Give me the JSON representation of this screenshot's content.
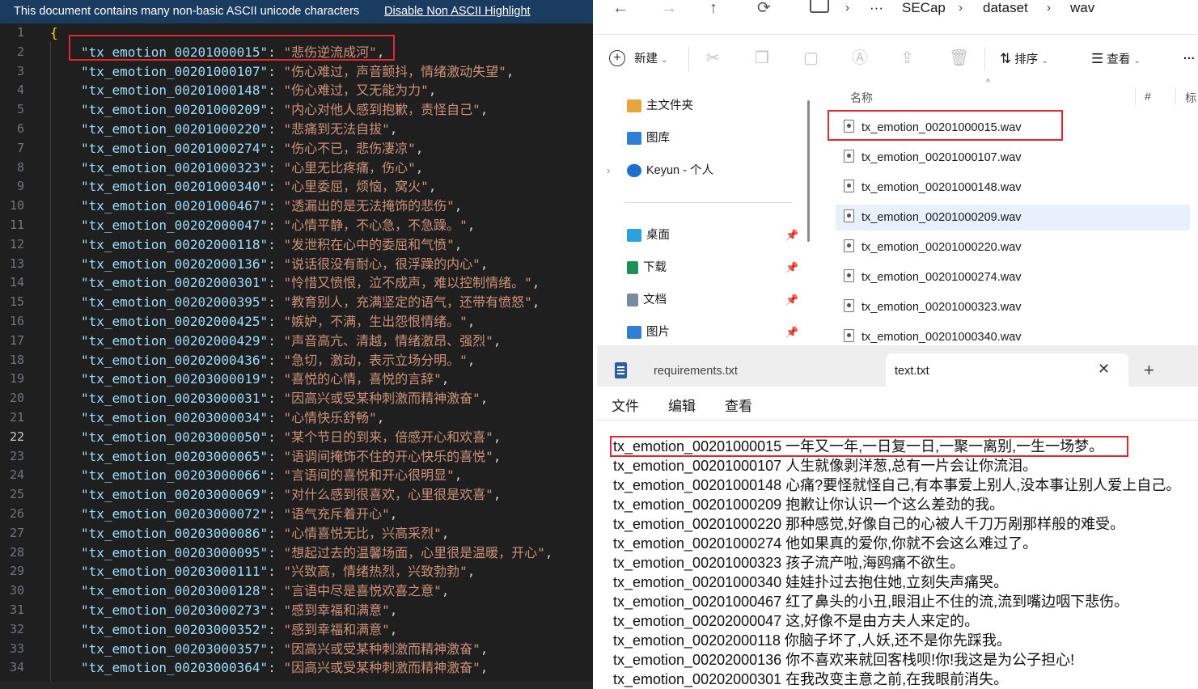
{
  "editor": {
    "banner": {
      "message": "This document contains many non-basic ASCII unicode characters",
      "link": "Disable Non ASCII Highlight"
    },
    "active_line": "22",
    "lines": [
      {
        "n": "1",
        "text": "{"
      },
      {
        "n": "2",
        "key": "\"tx_emotion_00201000015\"",
        "val": "\"悲伤逆流成河\"",
        "tail": ","
      },
      {
        "n": "3",
        "key": "\"tx_emotion_00201000107\"",
        "val": "\"伤心难过，声音颤抖，情绪激动失望\"",
        "tail": ","
      },
      {
        "n": "4",
        "key": "\"tx_emotion_00201000148\"",
        "val": "\"伤心难过，又无能为力\"",
        "tail": ","
      },
      {
        "n": "5",
        "key": "\"tx_emotion_00201000209\"",
        "val": "\"内心对他人感到抱歉，责怪自己\"",
        "tail": ","
      },
      {
        "n": "6",
        "key": "\"tx_emotion_00201000220\"",
        "val": "\"悲痛到无法自拔\"",
        "tail": ","
      },
      {
        "n": "7",
        "key": "\"tx_emotion_00201000274\"",
        "val": "\"伤心不已，悲伤凄凉\"",
        "tail": ","
      },
      {
        "n": "8",
        "key": "\"tx_emotion_00201000323\"",
        "val": "\"心里无比疼痛，伤心\"",
        "tail": ","
      },
      {
        "n": "9",
        "key": "\"tx_emotion_00201000340\"",
        "val": "\"心里委屈，烦恼，窝火\"",
        "tail": ","
      },
      {
        "n": "10",
        "key": "\"tx_emotion_00201000467\"",
        "val": "\"透漏出的是无法掩饰的悲伤\"",
        "tail": ","
      },
      {
        "n": "11",
        "key": "\"tx_emotion_00202000047\"",
        "val": "\"心情平静，不心急，不急躁。\"",
        "tail": ","
      },
      {
        "n": "12",
        "key": "\"tx_emotion_00202000118\"",
        "val": "\"发泄积在心中的委屈和气愤\"",
        "tail": ","
      },
      {
        "n": "13",
        "key": "\"tx_emotion_00202000136\"",
        "val": "\"说话很没有耐心，很浮躁的内心\"",
        "tail": ","
      },
      {
        "n": "14",
        "key": "\"tx_emotion_00202000301\"",
        "val": "\"怜惜又愤恨，泣不成声，难以控制情绪。\"",
        "tail": ","
      },
      {
        "n": "15",
        "key": "\"tx_emotion_00202000395\"",
        "val": "\"教育别人，充满坚定的语气，还带有愤怒\"",
        "tail": ","
      },
      {
        "n": "16",
        "key": "\"tx_emotion_00202000425\"",
        "val": "\"嫉妒，不满，生出怨恨情绪。\"",
        "tail": ","
      },
      {
        "n": "17",
        "key": "\"tx_emotion_00202000429\"",
        "val": "\"声音高亢、清越，情绪激昂、强烈\"",
        "tail": ","
      },
      {
        "n": "18",
        "key": "\"tx_emotion_00202000436\"",
        "val": "\"急切，激动，表示立场分明。\"",
        "tail": ","
      },
      {
        "n": "19",
        "key": "\"tx_emotion_00203000019\"",
        "val": "\"喜悦的心情，喜悦的言辞\"",
        "tail": ","
      },
      {
        "n": "20",
        "key": "\"tx_emotion_00203000031\"",
        "val": "\"因高兴或受某种刺激而精神激奋\"",
        "tail": ","
      },
      {
        "n": "21",
        "key": "\"tx_emotion_00203000034\"",
        "val": "\"心情快乐舒畅\"",
        "tail": ","
      },
      {
        "n": "22",
        "key": "\"tx_emotion_00203000050\"",
        "val": "\"某个节日的到来，倍感开心和欢喜\"",
        "tail": ","
      },
      {
        "n": "23",
        "key": "\"tx_emotion_00203000065\"",
        "val": "\"语调间掩饰不住的开心快乐的喜悦\"",
        "tail": ","
      },
      {
        "n": "24",
        "key": "\"tx_emotion_00203000066\"",
        "val": "\"言语间的喜悦和开心很明显\"",
        "tail": ","
      },
      {
        "n": "25",
        "key": "\"tx_emotion_00203000069\"",
        "val": "\"对什么感到很喜欢，心里很是欢喜\"",
        "tail": ","
      },
      {
        "n": "26",
        "key": "\"tx_emotion_00203000072\"",
        "val": "\"语气充斥着开心\"",
        "tail": ","
      },
      {
        "n": "27",
        "key": "\"tx_emotion_00203000086\"",
        "val": "\"心情喜悦无比，兴高采烈\"",
        "tail": ","
      },
      {
        "n": "28",
        "key": "\"tx_emotion_00203000095\"",
        "val": "\"想起过去的温馨场面，心里很是温暖，开心\"",
        "tail": ","
      },
      {
        "n": "29",
        "key": "\"tx_emotion_00203000111\"",
        "val": "\"兴致高，情绪热烈，兴致勃勃\"",
        "tail": ","
      },
      {
        "n": "30",
        "key": "\"tx_emotion_00203000128\"",
        "val": "\"言语中尽是喜悦欢喜之意\"",
        "tail": ","
      },
      {
        "n": "31",
        "key": "\"tx_emotion_00203000273\"",
        "val": "\"感到幸福和满意\"",
        "tail": ","
      },
      {
        "n": "32",
        "key": "\"tx_emotion_00203000352\"",
        "val": "\"感到幸福和满意\"",
        "tail": ","
      },
      {
        "n": "33",
        "key": "\"tx_emotion_00203000357\"",
        "val": "\"因高兴或受某种刺激而精神激奋\"",
        "tail": ","
      },
      {
        "n": "34",
        "key": "\"tx_emotion_00203000364\"",
        "val": "\"因高兴或受某种刺激而精神激奋\"",
        "tail": ","
      }
    ]
  },
  "explorer": {
    "nav": {
      "back": "←",
      "forward": "→",
      "up": "↑",
      "refresh": "⟳",
      "more": "···"
    },
    "breadcrumb": [
      "SECap",
      "dataset",
      "wav"
    ],
    "commands": {
      "new_label": "新建",
      "sort_label": "排序",
      "view_label": "查看",
      "more": "···"
    },
    "sidebar": [
      {
        "label": "主文件夹",
        "icon": "home-icon",
        "color": "#e8a53c"
      },
      {
        "label": "图库",
        "icon": "gallery-icon",
        "color": "#2f7fd6"
      },
      {
        "label": "Keyun - 个人",
        "icon": "cloud-icon",
        "color": "#1f6fd0"
      },
      {
        "label": "桌面",
        "icon": "desktop-icon",
        "color": "#2aa0e0"
      },
      {
        "label": "下载",
        "icon": "download-icon",
        "color": "#1f8f5a"
      },
      {
        "label": "文档",
        "icon": "document-icon",
        "color": "#7a8aa0"
      },
      {
        "label": "图片",
        "icon": "picture-icon",
        "color": "#2f7fd6"
      }
    ],
    "columns": {
      "name": "名称",
      "hash": "#",
      "tag": "标"
    },
    "files": [
      "tx_emotion_00201000015.wav",
      "tx_emotion_00201000107.wav",
      "tx_emotion_00201000148.wav",
      "tx_emotion_00201000209.wav",
      "tx_emotion_00201000220.wav",
      "tx_emotion_00201000274.wav",
      "tx_emotion_00201000323.wav",
      "tx_emotion_00201000340.wav"
    ],
    "selected_file": "tx_emotion_00201000209.wav"
  },
  "notepad": {
    "tabs": [
      "requirements.txt",
      "text.txt"
    ],
    "active_tab": "text.txt",
    "close": "✕",
    "new_tab": "+",
    "menu": [
      "文件",
      "编辑",
      "查看"
    ],
    "lines": [
      "tx_emotion_00201000015 一年又一年,一日复一日,一聚一离别,一生一场梦。",
      "tx_emotion_00201000107 人生就像剥洋葱,总有一片会让你流泪。",
      "tx_emotion_00201000148 心痛?要怪就怪自己,有本事爱上别人,没本事让别人爱上自己。",
      "tx_emotion_00201000209 抱歉让你认识一个这么差劲的我。",
      "tx_emotion_00201000220 那种感觉,好像自己的心被人千刀万剐那样般的难受。",
      "tx_emotion_00201000274 他如果真的爱你,你就不会这么难过了。",
      "tx_emotion_00201000323 孩子流产啦,海鸥痛不欲生。",
      "tx_emotion_00201000340 娃娃扑过去抱住她,立刻失声痛哭。",
      "tx_emotion_00201000467 红了鼻头的小丑,眼泪止不住的流,流到嘴边咽下悲伤。",
      "tx_emotion_00202000047 这,好像不是由方夫人来定的。",
      "tx_emotion_00202000118 你脑子坏了,人妖,还不是你先踩我。",
      "tx_emotion_00202000136 你不喜欢来就回客栈呗!你!我这是为公子担心!",
      "tx_emotion_00202000301 在我改变主意之前,在我眼前消失。"
    ]
  }
}
